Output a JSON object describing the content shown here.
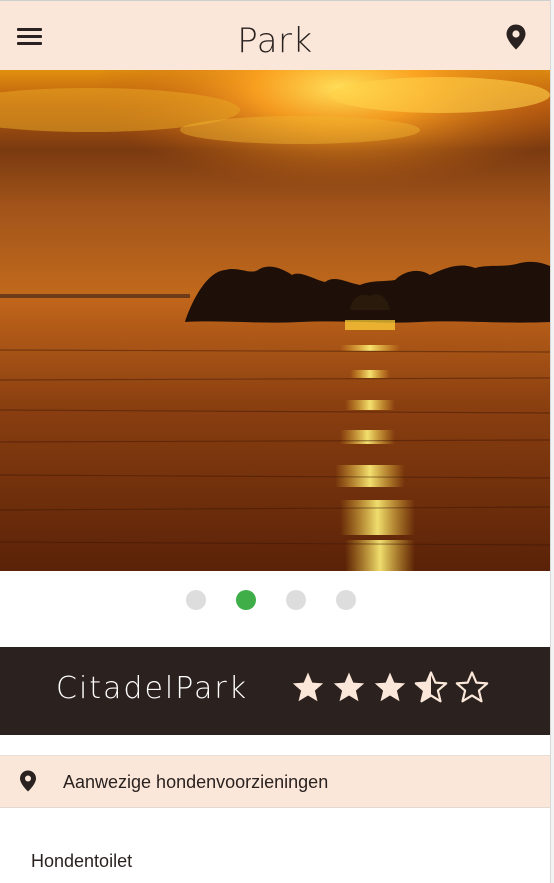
{
  "header": {
    "title": "Park",
    "menu_icon": "hamburger-menu-icon",
    "location_icon": "map-pin-icon"
  },
  "carousel": {
    "image_description": "sunset-over-lake-photo",
    "slide_count": 4,
    "active_index": 1,
    "dots": [
      "slide-1",
      "slide-2",
      "slide-3",
      "slide-4"
    ],
    "active_color": "#3fae49",
    "inactive_color": "#dddddd"
  },
  "park": {
    "name": "CitadelPark",
    "rating": 3.5,
    "rating_max": 5
  },
  "facilities": {
    "section_label": "Aanwezige hondenvoorzieningen",
    "items": [
      "Hondentoilet"
    ]
  },
  "colors": {
    "header_bg": "#fbe7d9",
    "namebar_bg": "#2b211e",
    "star_color": "#fbe7d9"
  }
}
